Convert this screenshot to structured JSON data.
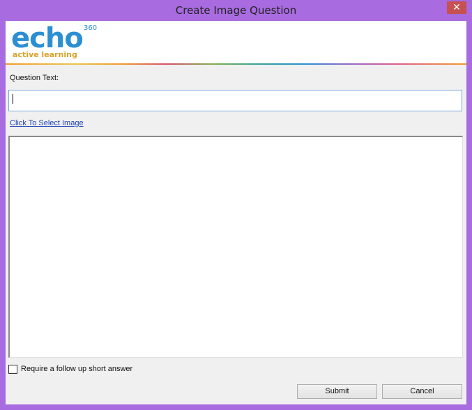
{
  "window": {
    "title": "Create Image Question",
    "close_glyph": "✕"
  },
  "logo": {
    "brand": "echo",
    "superscript": "360",
    "tagline": "active learning",
    "brand_color": "#2b8fd1",
    "tagline_color": "#d9a227"
  },
  "form": {
    "question_label": "Question Text:",
    "question_value": "",
    "select_image_link": "Click To Select Image",
    "followup_label": "Require a follow up short answer",
    "followup_checked": false
  },
  "buttons": {
    "submit": "Submit",
    "cancel": "Cancel"
  },
  "colors": {
    "window_frame": "#a86be0",
    "client_bg": "#f0f0f0",
    "link": "#1d3fb5",
    "close_button": "#c75050"
  }
}
